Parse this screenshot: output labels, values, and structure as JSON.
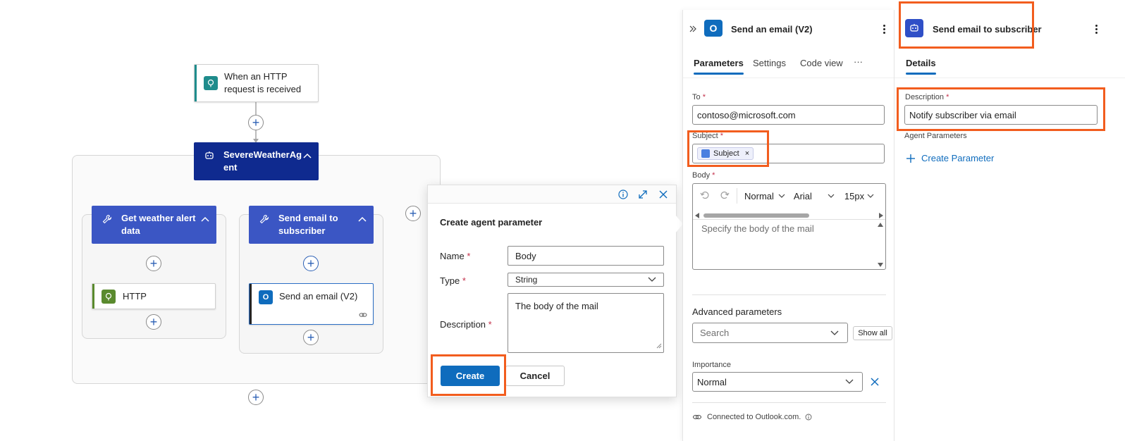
{
  "canvas": {
    "trigger_label": "When an HTTP request is received",
    "agent_label": "SevereWeatherAgent",
    "tool1_label": "Get weather alert data",
    "tool2_label": "Send email to subscriber",
    "http_label": "HTTP",
    "send_email_label": "Send an email (V2)"
  },
  "dialog": {
    "title": "Create agent parameter",
    "name_label": "Name",
    "name_value": "Body",
    "type_label": "Type",
    "type_value": "String",
    "description_label": "Description",
    "description_value": "The body of the mail",
    "required_mark": "*",
    "create_label": "Create",
    "cancel_label": "Cancel"
  },
  "panel_email": {
    "title": "Send an email (V2)",
    "tabs": [
      "Parameters",
      "Settings",
      "Code view",
      "···"
    ],
    "to_label": "To",
    "to_value": "contoso@microsoft.com",
    "subject_label": "Subject",
    "subject_token": "Subject",
    "token_remove": "×",
    "body_label": "Body",
    "font_style": "Normal",
    "font_family": "Arial",
    "font_size": "15px",
    "body_placeholder": "Specify the body of the mail",
    "advanced_label": "Advanced parameters",
    "search_placeholder": "Search",
    "show_all": "Show all",
    "importance_label": "Importance",
    "importance_value": "Normal",
    "connection_text": "Connected to Outlook.com.",
    "required_mark": "*"
  },
  "panel_agent": {
    "title": "Send email to subscriber",
    "tab": "Details",
    "description_label": "Description",
    "description_value": "Notify subscriber via email",
    "agent_params_label": "Agent Parameters",
    "create_param": "Create Parameter",
    "required_mark": "*"
  },
  "colors": {
    "agent_dark": "#0f2a8f",
    "tool_blue": "#3b56c4",
    "accent_blue": "#0f6cbd",
    "highlight_orange": "#f25d1e",
    "http_green": "#5a8a2e",
    "trigger_teal": "#1f8c8c"
  }
}
